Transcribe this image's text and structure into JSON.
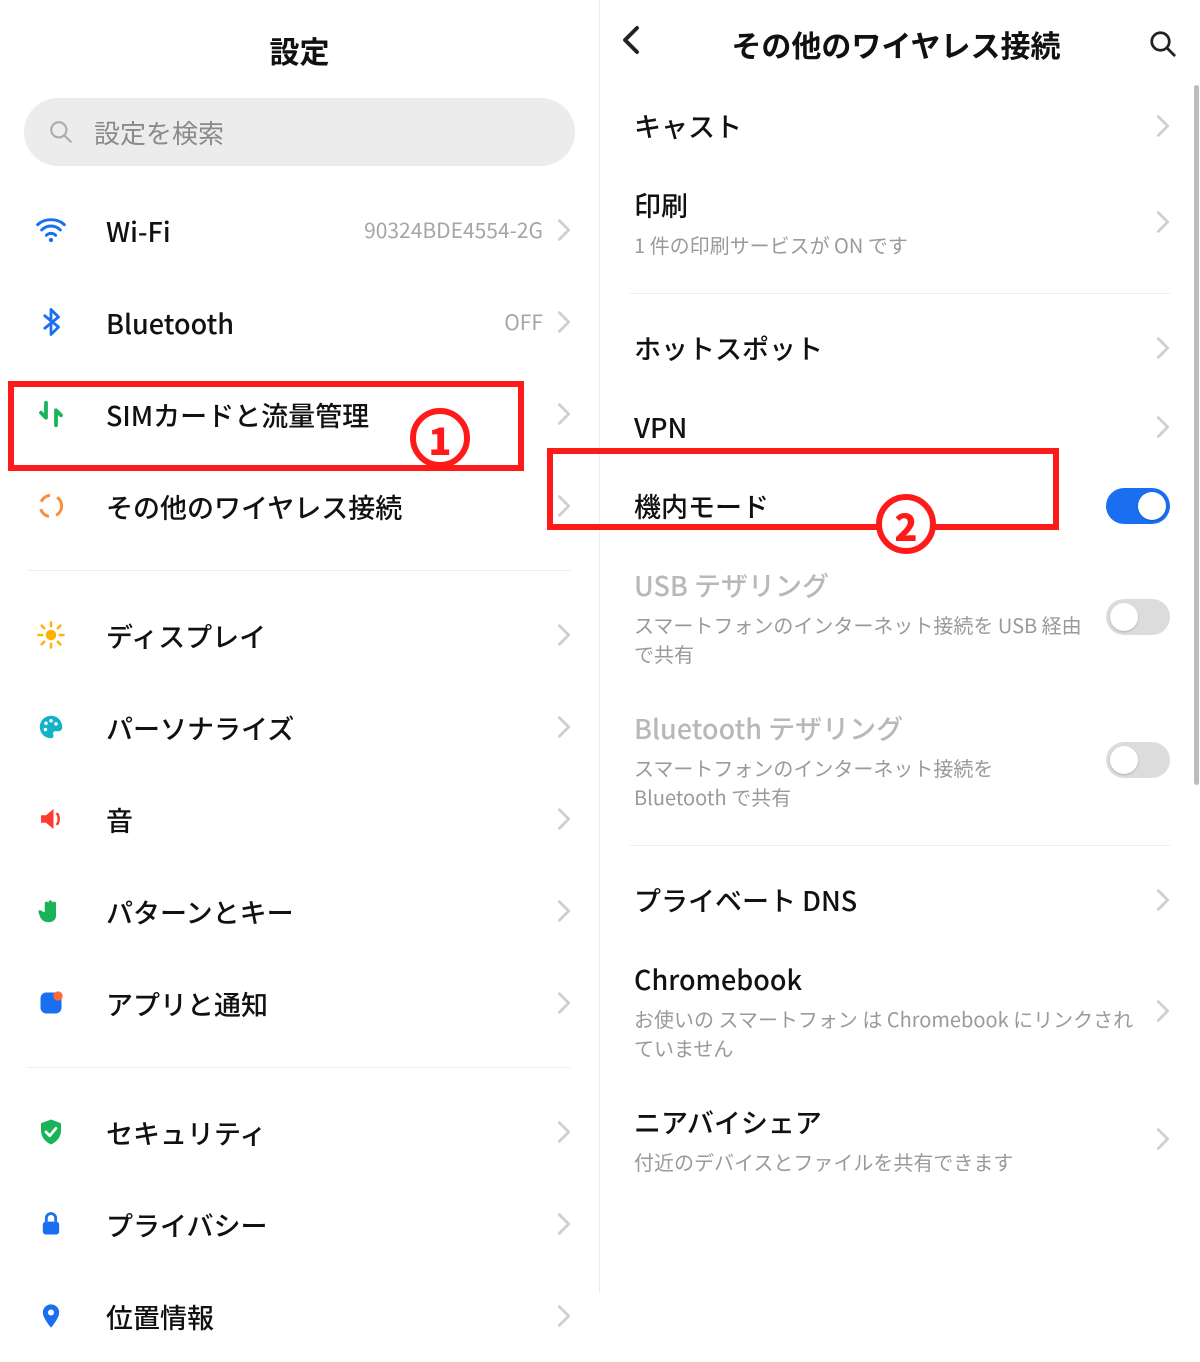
{
  "annotations": {
    "badge1": "1",
    "badge2": "2"
  },
  "left": {
    "title": "設定",
    "search_placeholder": "設定を検索",
    "items": [
      {
        "key": "wifi",
        "label": "Wi-Fi",
        "value": "90324BDE4554-2G"
      },
      {
        "key": "bluetooth",
        "label": "Bluetooth",
        "value": "OFF"
      },
      {
        "key": "sim",
        "label": "SIMカードと流量管理"
      },
      {
        "key": "other-wireless",
        "label": "その他のワイヤレス接続"
      },
      {
        "key": "display",
        "label": "ディスプレイ"
      },
      {
        "key": "personalize",
        "label": "パーソナライズ"
      },
      {
        "key": "sound",
        "label": "音"
      },
      {
        "key": "pattern-key",
        "label": "パターンとキー"
      },
      {
        "key": "apps-notifications",
        "label": "アプリと通知"
      },
      {
        "key": "security",
        "label": "セキュリティ"
      },
      {
        "key": "privacy",
        "label": "プライバシー"
      },
      {
        "key": "location",
        "label": "位置情報"
      }
    ]
  },
  "right": {
    "title": "その他のワイヤレス接続",
    "items": [
      {
        "key": "cast",
        "label": "キャスト",
        "kind": "nav"
      },
      {
        "key": "print",
        "label": "印刷",
        "sub": "1 件の印刷サービスが ON です",
        "kind": "nav"
      },
      {
        "key": "hotspot",
        "label": "ホットスポット",
        "kind": "nav"
      },
      {
        "key": "vpn",
        "label": "VPN",
        "kind": "nav"
      },
      {
        "key": "airplane",
        "label": "機内モード",
        "kind": "toggle",
        "on": true
      },
      {
        "key": "usb-tether",
        "label": "USB テザリング",
        "sub": "スマートフォンのインターネット接続を USB 経由で共有",
        "kind": "toggle",
        "on": false,
        "disabled": true
      },
      {
        "key": "bt-tether",
        "label": "Bluetooth テザリング",
        "sub": "スマートフォンのインターネット接続を Bluetooth で共有",
        "kind": "toggle",
        "on": false,
        "disabled": true
      },
      {
        "key": "private-dns",
        "label": "プライベート DNS",
        "kind": "nav"
      },
      {
        "key": "chromebook",
        "label": "Chromebook",
        "sub": "お使いの スマートフォン は Chromebook にリンクされていません",
        "kind": "nav"
      },
      {
        "key": "nearby-share",
        "label": "ニアバイシェア",
        "sub": "付近のデバイスとファイルを共有できます",
        "kind": "nav"
      }
    ]
  }
}
